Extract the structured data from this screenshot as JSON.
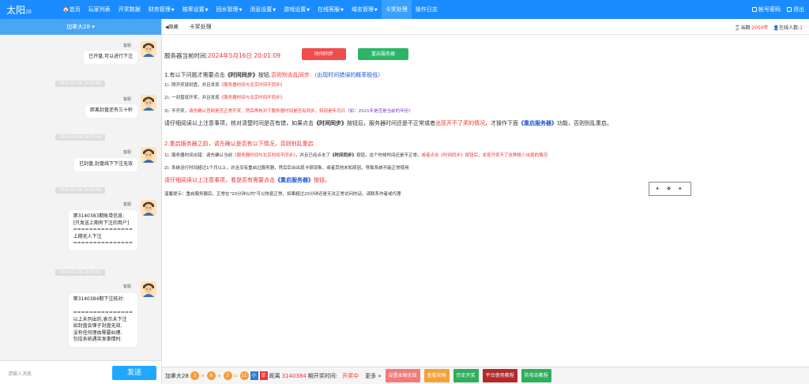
{
  "app": {
    "logo": "太阳",
    "logo_suffix": "28"
  },
  "nav": [
    {
      "label": "🏠首页",
      "dropdown": false
    },
    {
      "label": "玩家列表",
      "dropdown": false
    },
    {
      "label": "开奖数据",
      "dropdown": false
    },
    {
      "label": "财务管理",
      "dropdown": true
    },
    {
      "label": "赔率设置",
      "dropdown": true
    },
    {
      "label": "回水管理",
      "dropdown": true
    },
    {
      "label": "消息设置",
      "dropdown": true
    },
    {
      "label": "游戏设置",
      "dropdown": true
    },
    {
      "label": "在线客服",
      "dropdown": true
    },
    {
      "label": "域名管理",
      "dropdown": true
    },
    {
      "label": "卡奖处理",
      "dropdown": false,
      "active": true
    },
    {
      "label": "操作日志",
      "dropdown": false
    }
  ],
  "topright": {
    "password": "帐号密码",
    "logout": "退出"
  },
  "chat": {
    "header": "加拿大28",
    "sender": "客服",
    "messages": [
      {
        "text": "已开盘,可以进行下注"
      },
      {
        "text": "距离封盘还有三十秒"
      },
      {
        "text": "已封盘,封盘线下下注无效"
      },
      {
        "text": "第3140383期账单信息:\n[只发送上期有下注的用户]\n===============\n上期无人下注\n==============="
      },
      {
        "text": "第3140384期下注核对:\n\n===============\n以上未列出的,表示未下注\n如封盘会锋于封盘无效.\n没有任何理由需要纠缠.\n包括系统遇突发事情时."
      }
    ],
    "timestamps": [
      "2024-05-16 19:33:45",
      "2024-05-16 19:33:46",
      "2024-05-16 19:33:46",
      "2024-05-16 19:33:51"
    ],
    "input_placeholder": "请输入消息",
    "send_label": "发送"
  },
  "tabs": {
    "collapse": "◀隐藏",
    "current": "卡奖处理"
  },
  "status": {
    "period_label": "当期:",
    "period_value": "2050年",
    "online_label": "在线人数:",
    "online_value": "1"
  },
  "main": {
    "server_time_label": "服务器当前时间:",
    "server_time": "2024年5月16日 20:01:09",
    "btn_sync": "时间同步",
    "btn_restart": "重启服务器",
    "s1_title_a": "1.有以下问题才需要点击",
    "s1_title_b": "《时间同步》",
    "s1_title_c": "按钮,",
    "s1_title_d": "否则别去乱同步:",
    "s1_title_e": "（出现时间错误的概率极低）",
    "s1_l1_a": "1). 刚开奖就封盘，并且发现",
    "s1_l1_b": "《服务器时间与北京时间不同步》",
    "s1_l2_a": "2). 一封盘就开奖，并且发现",
    "s1_l2_b": "《服务器时间与北京时间不同步》",
    "s1_l3_a": "3). 不开奖，",
    "s1_l3_b": "请先确认官网是否正常开奖，然后再核对下服务器时间是否有同步，特别是年月日",
    "s1_l3_c": "（如：2021年是否是当前的年份）",
    "s1_note_a": "请仔细阅读以上注意事项，核对清楚时间是否有错，如果点击",
    "s1_note_b": "《时间同步》",
    "s1_note_c": "按钮后，服务器时间还是不正常或者",
    "s1_note_d": "出现开不了奖的情况",
    "s1_note_e": "，才操作下面",
    "s1_note_f": "《重启服务器》",
    "s1_note_g": "功能，否则别乱重启。",
    "s2_title": "2.重启服务器之前，请先确认是否有以下情况，否则别乱重启",
    "s2_l1_a": "1). 服务器时间出错：请先确认当前",
    "s2_l1_b": "《服务器时间与北京时间不同步》",
    "s2_l1_c": "，并且已经点击了",
    "s2_l1_d": "《时间同步》",
    "s2_l1_e": "按钮，这个时候时间还是不正常。",
    "s2_l1_f": "或者点击《时间同步》按钮后，发现开奖不了这种极少出现的情况",
    "s2_l2": "2). 系统运行时间超过1个月以上，并且没有重启过服务器，然后后台出现卡顿现象，或者其他未知原因，导致系统不能正常使用",
    "s2_note_a": "请仔细阅读以上注意事项，看是否有需要点击",
    "s2_note_b": "《重启服务器》",
    "s2_note_c": "按钮。",
    "tip": "温馨提示：重启服务器后，正常在\"20分钟以内\"可以恢复正常，如果超过20分钟还是无法正常访问的话，请联系作者或代理"
  },
  "bottom": {
    "game": "加拿大28",
    "balls": [
      "3",
      "6",
      "2",
      "11"
    ],
    "tags": [
      {
        "label": "小",
        "color": "#2a7fd4"
      },
      {
        "label": "单",
        "color": "#e33"
      }
    ],
    "after_tags": "距离",
    "period": "3140384",
    "period_suffix": "期开奖时间:",
    "open_status": "开奖中",
    "more": "更多 »",
    "buttons": [
      {
        "label": "设置本期无效",
        "color": "#f27a7a"
      },
      {
        "label": "查看官网",
        "color": "#f2a23a"
      },
      {
        "label": "历史开奖",
        "color": "#2fae5b"
      },
      {
        "label": "平台使用教程",
        "color": "#b12a2a"
      },
      {
        "label": "防攻击教程",
        "color": "#2fae5b"
      }
    ]
  },
  "colors": {
    "topbar": "#1a8cff",
    "chat_header": "#4aa6f5",
    "send": "#20a8ff"
  }
}
